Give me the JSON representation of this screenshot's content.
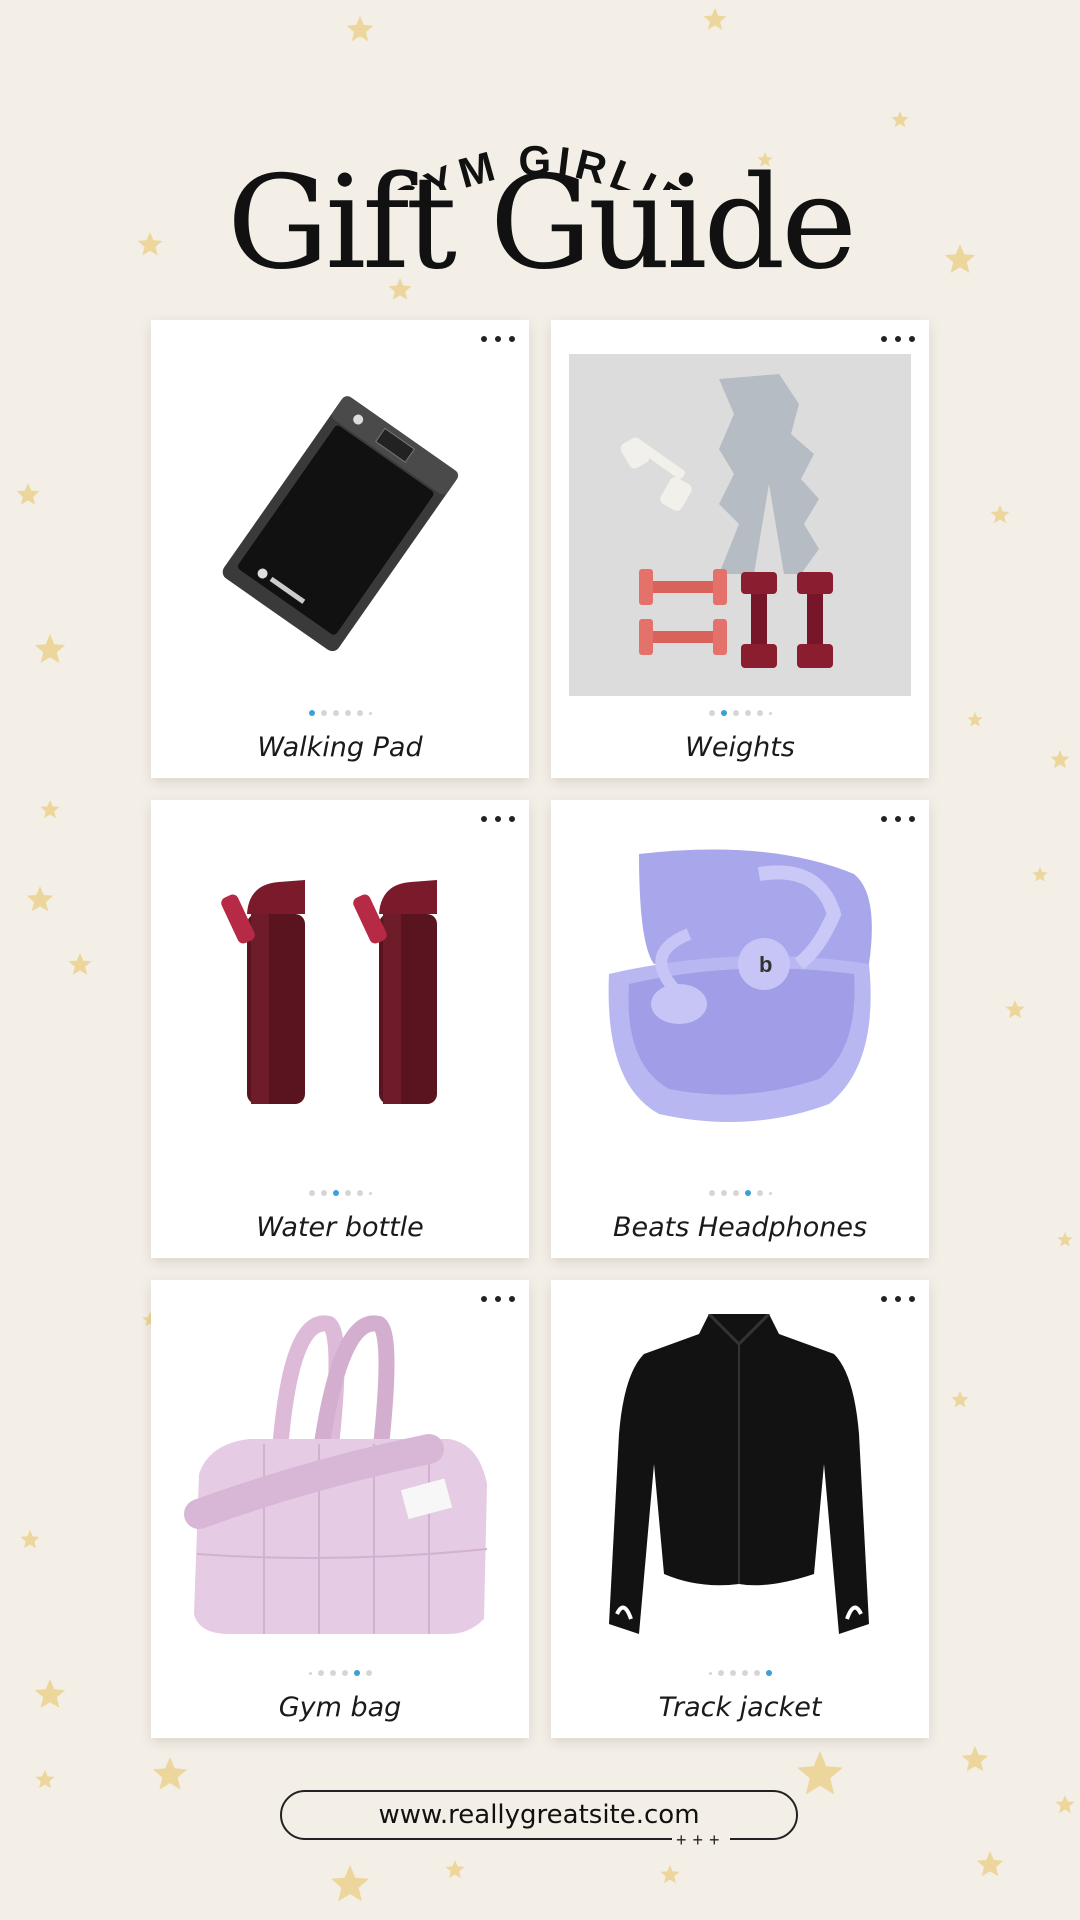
{
  "header": {
    "subtitle": "GYM GIRLIE",
    "title": "Gift Guide"
  },
  "colors": {
    "background": "#f3eee6",
    "star": "#e8c35c",
    "active_dot": "#3aa0d8"
  },
  "cards": [
    {
      "label": "Walking Pad",
      "image": "walking-pad-image",
      "active_slide": 1,
      "total_slides": 6
    },
    {
      "label": "Weights",
      "image": "dumbbells-image",
      "active_slide": 2,
      "total_slides": 6
    },
    {
      "label": "Water bottle",
      "image": "water-bottles-image",
      "active_slide": 3,
      "total_slides": 6
    },
    {
      "label": "Beats Headphones",
      "image": "earbuds-case-image",
      "active_slide": 4,
      "total_slides": 6
    },
    {
      "label": "Gym bag",
      "image": "duffel-bag-image",
      "active_slide": 5,
      "total_slides": 6
    },
    {
      "label": "Track jacket",
      "image": "black-jacket-image",
      "active_slide": 6,
      "total_slides": 6
    }
  ],
  "footer": {
    "url": "www.reallygreatsite.com",
    "sparkle": "+++"
  }
}
